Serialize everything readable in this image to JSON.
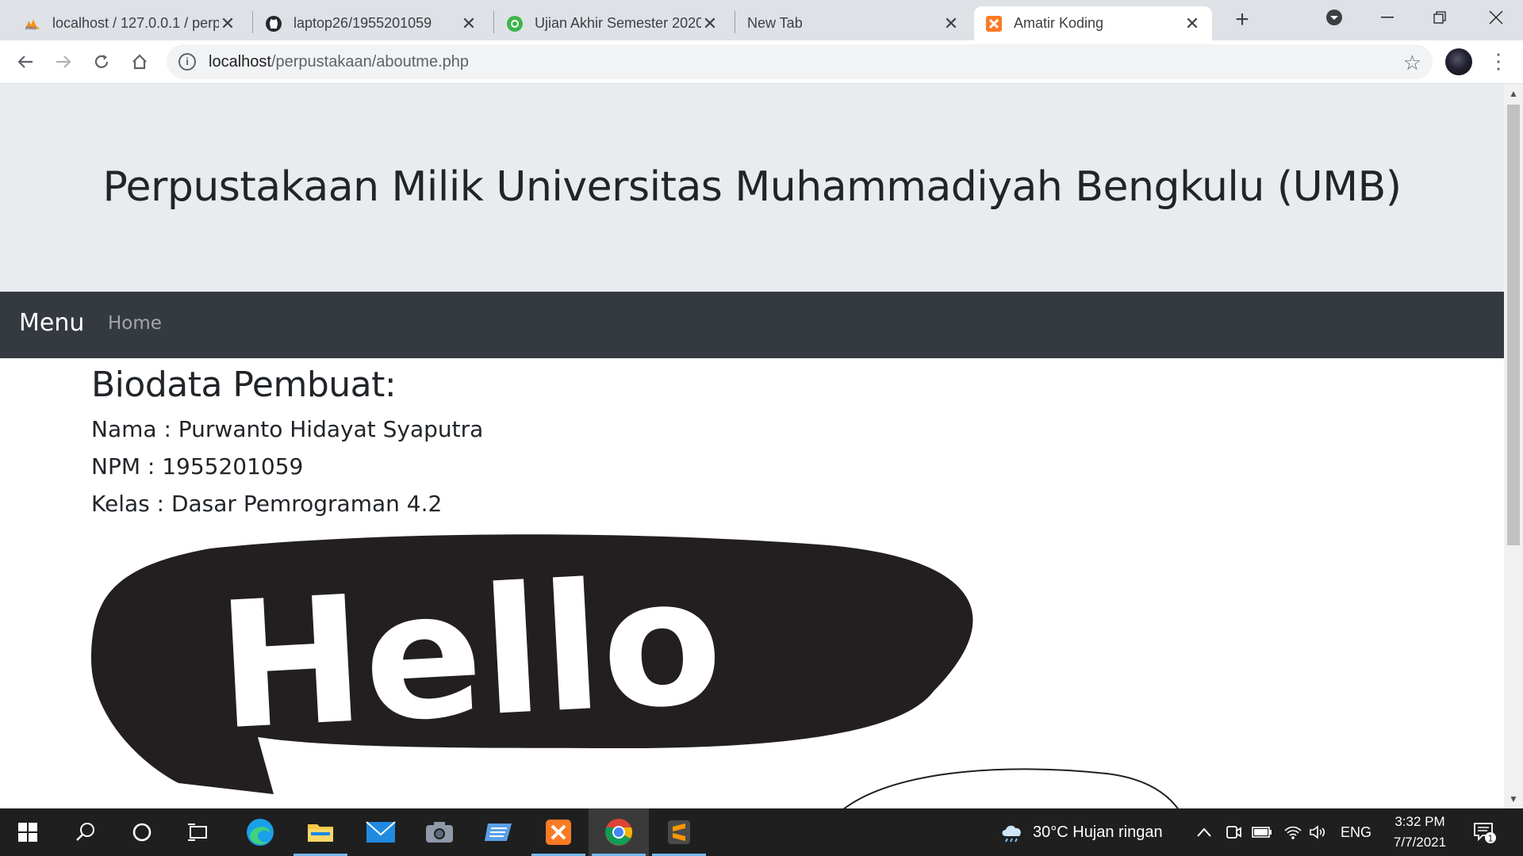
{
  "browser": {
    "tabs": [
      {
        "title": "localhost / 127.0.0.1 / perp",
        "icon": "phpmyadmin-icon",
        "active": false
      },
      {
        "title": "laptop26/1955201059",
        "icon": "github-icon",
        "active": false
      },
      {
        "title": "Ujian Akhir Semester 2020",
        "icon": "moodle-icon",
        "active": false
      },
      {
        "title": "New Tab",
        "icon": "",
        "active": false
      },
      {
        "title": "Amatir Koding",
        "icon": "xampp-icon",
        "active": true
      }
    ],
    "new_tab_label": "+",
    "url_host": "localhost",
    "url_path": "/perpustakaan/aboutme.php"
  },
  "page": {
    "header_title": "Perpustakaan Milik Universitas Muhammadiyah Bengkulu (UMB)",
    "navbar": {
      "brand": "Menu",
      "links": [
        "Home"
      ]
    },
    "heading": "Biodata Pembuat:",
    "lines": [
      "Nama : Purwanto Hidayat Syaputra",
      "NPM : 1955201059",
      "Kelas : Dasar Pemrograman 4.2"
    ],
    "image_text": "Hello"
  },
  "taskbar": {
    "weather": "30°C  Hujan ringan",
    "language": "ENG",
    "time": "3:32 PM",
    "date": "7/7/2021",
    "notification_count": "1"
  },
  "colors": {
    "jumbotron_bg": "#e9ecef",
    "navbar_bg": "#343a40",
    "tabstrip_bg": "#dee1e6",
    "taskbar_bg": "#1f1f1f"
  }
}
